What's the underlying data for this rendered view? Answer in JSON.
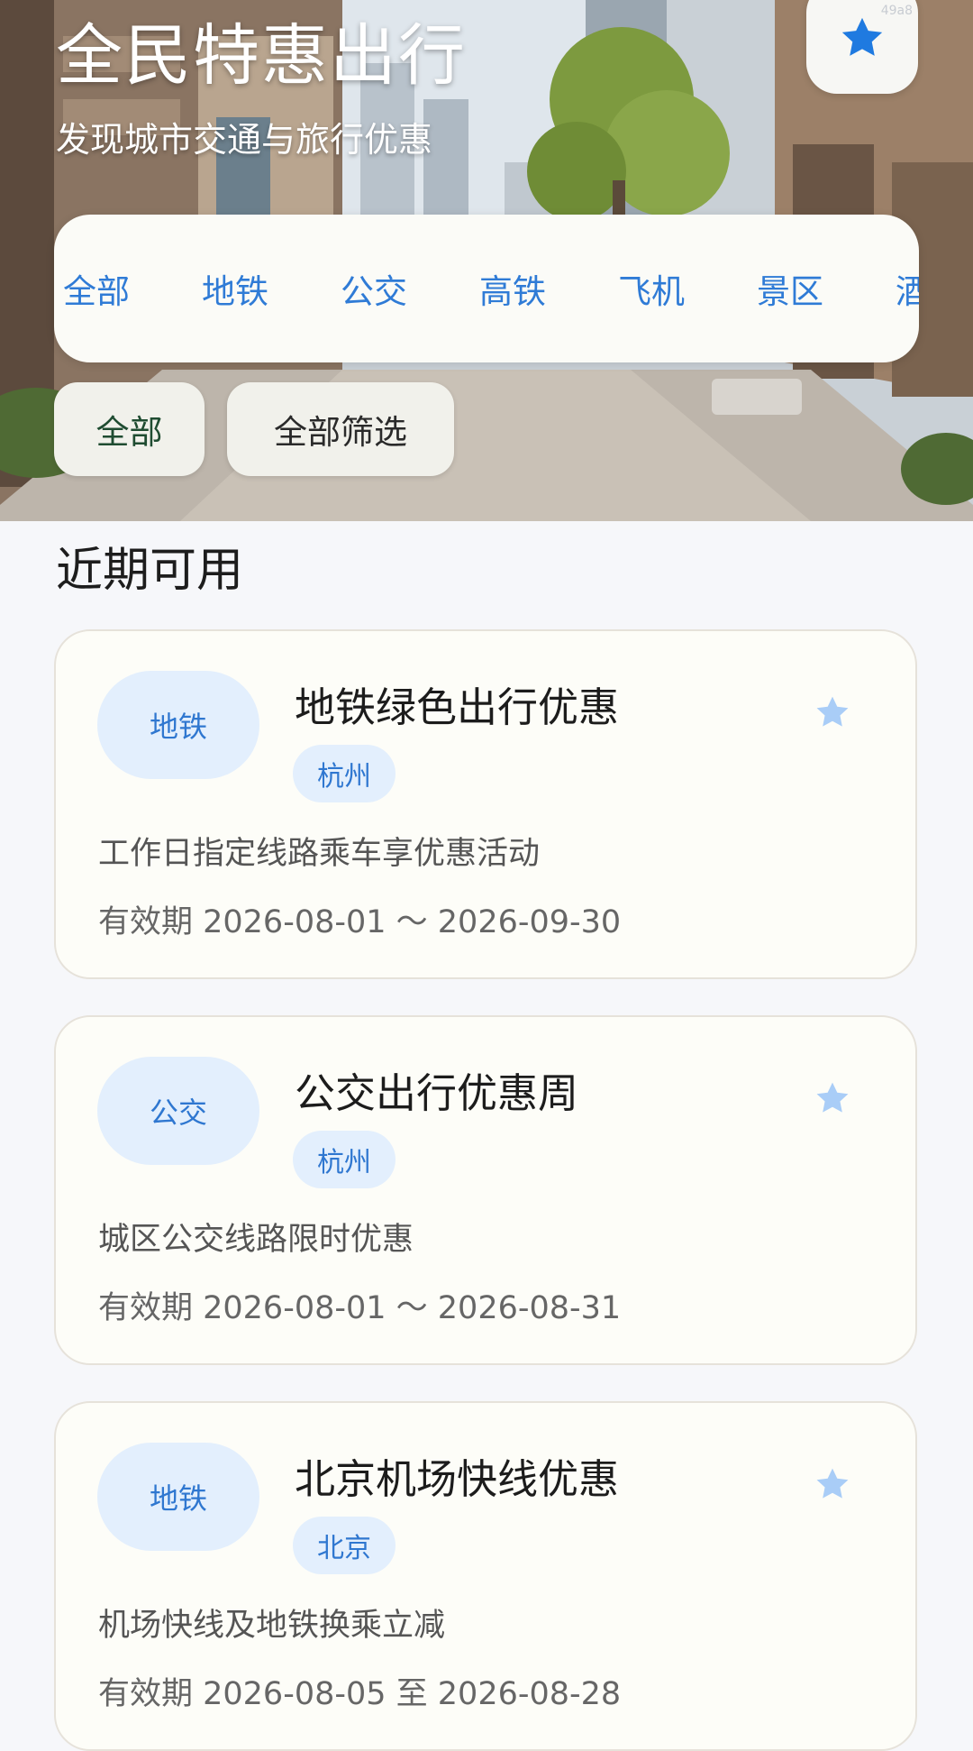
{
  "header": {
    "title": "全民特惠出行",
    "subtitle": "发现城市交通与旅行优惠",
    "fav_icon": "star-icon",
    "fav_tag": "49a8"
  },
  "categories": [
    "全部",
    "地铁",
    "公交",
    "高铁",
    "飞机",
    "景区",
    "酒店"
  ],
  "chips": {
    "region": "全部",
    "filter": "全部筛选"
  },
  "section": {
    "title": "近期可用"
  },
  "deals": [
    {
      "type": "地铁",
      "title": "地铁绿色出行优惠",
      "city": "杭州",
      "desc": "工作日指定线路乘车享优惠活动",
      "validity": "有效期 2026-08-01 ～ 2026-09-30"
    },
    {
      "type": "公交",
      "title": "公交出行优惠周",
      "city": "杭州",
      "desc": "城区公交线路限时优惠",
      "validity": "有效期 2026-08-01 ～ 2026-08-31"
    },
    {
      "type": "地铁",
      "title": "北京机场快线优惠",
      "city": "北京",
      "desc": "机场快线及地铁换乘立减",
      "validity": "有效期 2026-08-05 至 2026-08-28"
    }
  ],
  "colors": {
    "accent": "#2f7bd6",
    "badge_bg": "#e3effd",
    "star_light": "#a9cdf7",
    "star_strong": "#1f7ae0"
  }
}
